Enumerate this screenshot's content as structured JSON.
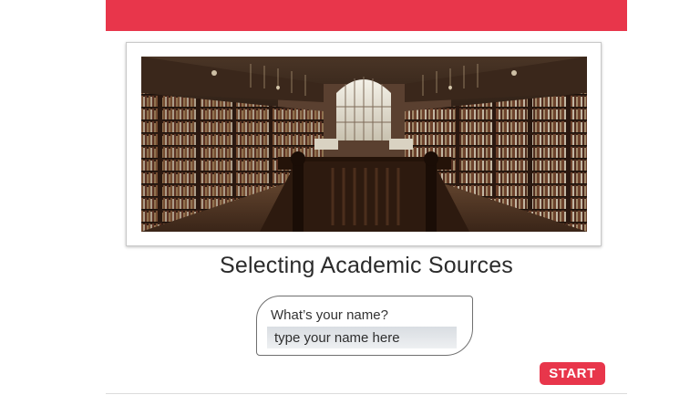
{
  "header": {
    "accent_color": "#e8364b"
  },
  "hero": {
    "image_name": "library-hall-photo"
  },
  "title": "Selecting Academic Sources",
  "name_prompt": {
    "label": "What’s your name?",
    "placeholder": "type your name here",
    "value": ""
  },
  "start_button": {
    "label": "START"
  }
}
